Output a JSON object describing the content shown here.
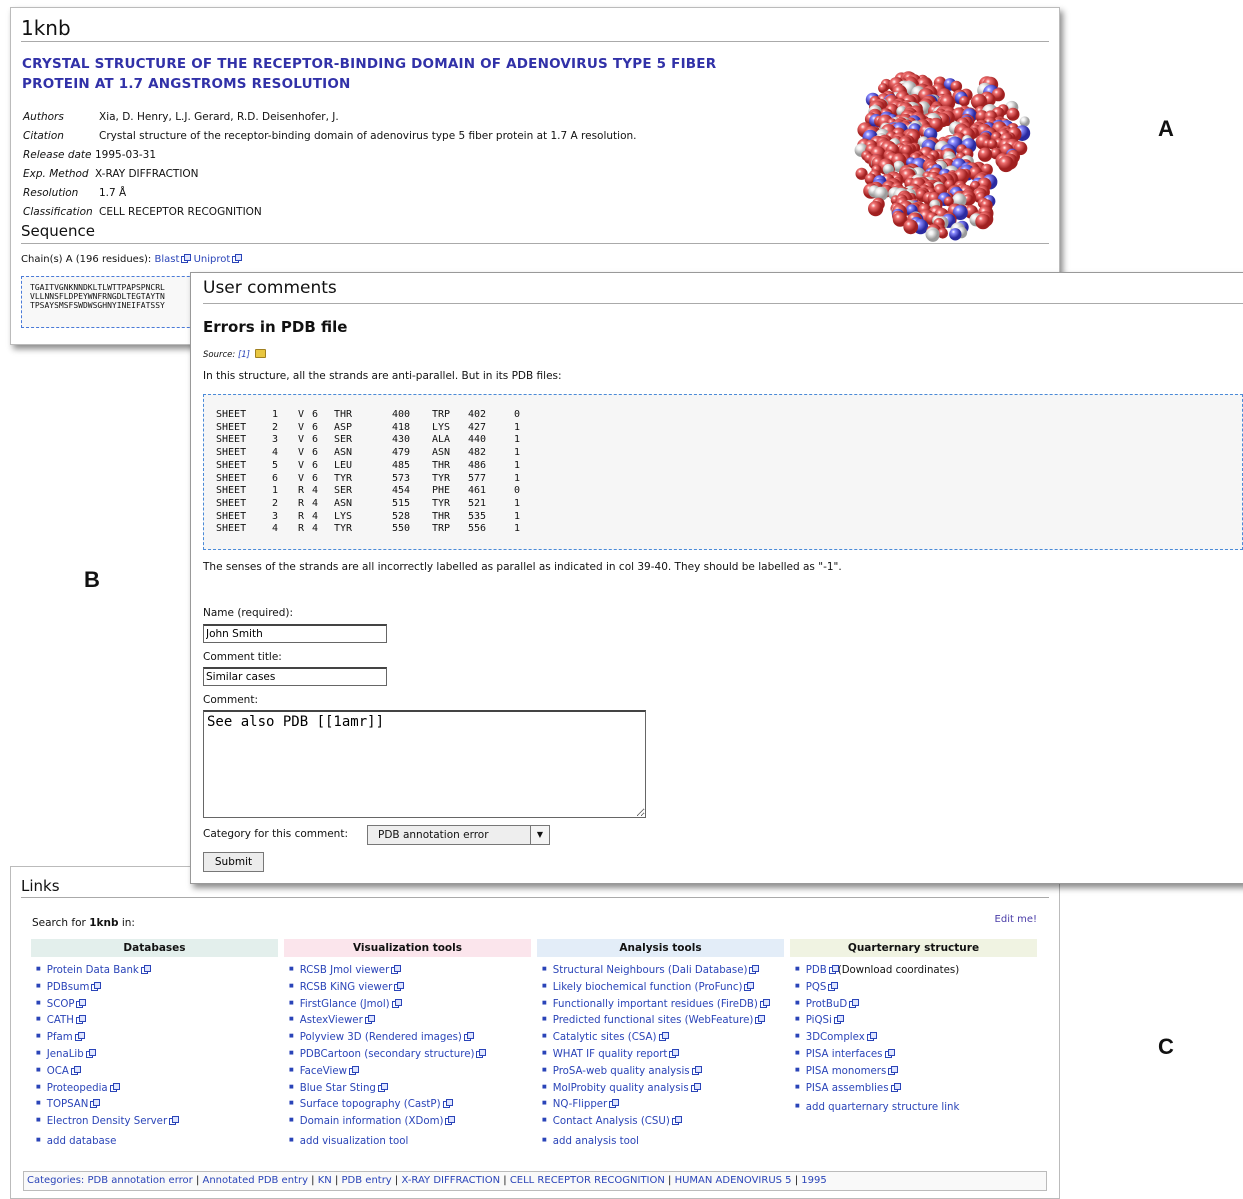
{
  "panel_a": {
    "page_title": "1knb",
    "title": "CRYSTAL STRUCTURE OF THE RECEPTOR-BINDING DOMAIN OF ADENOVIRUS TYPE 5 FIBER PROTEIN AT 1.7 ANGSTROMS RESOLUTION",
    "meta": [
      {
        "key": "Authors",
        "value": "Xia, D. Henry, L.J. Gerard, R.D. Deisenhofer, J."
      },
      {
        "key": "Citation",
        "value": "Crystal structure of the receptor-binding domain of adenovirus type 5 fiber protein at 1.7 A resolution."
      },
      {
        "key": "Release date",
        "value": "1995-03-31"
      },
      {
        "key": "Exp. Method",
        "value": "X-RAY DIFFRACTION"
      },
      {
        "key": "Resolution",
        "value": "1.7 Å"
      },
      {
        "key": "Classification",
        "value": "CELL RECEPTOR RECOGNITION"
      }
    ],
    "sequence_heading": "Sequence",
    "chain_text": "Chain(s) A (196 residues):",
    "blast_link": "Blast",
    "uniprot_link": "Uniprot",
    "sequence_lines": [
      "TGAITVGNKNNDKLTLWTTPAPSPNCRL",
      "VLLNNSFLDPEYWNFRNGDLTEGTAYTN",
      "TPSAYSMSFSWDWSGHNYINEIFATSSY"
    ]
  },
  "labels": {
    "a": "A",
    "b": "B",
    "c": "C"
  },
  "panel_b": {
    "heading": "User comments",
    "comment_title": "Errors in PDB file",
    "source_label": "Source:",
    "source_link": "[1]",
    "intro": "In this structure, all the strands are anti-parallel. But in its PDB files:",
    "sheet_rows": [
      [
        "SHEET",
        "1",
        "V",
        "6",
        "THR",
        "400",
        "TRP",
        "402",
        "0"
      ],
      [
        "SHEET",
        "2",
        "V",
        "6",
        "ASP",
        "418",
        "LYS",
        "427",
        "1"
      ],
      [
        "SHEET",
        "3",
        "V",
        "6",
        "SER",
        "430",
        "ALA",
        "440",
        "1"
      ],
      [
        "SHEET",
        "4",
        "V",
        "6",
        "ASN",
        "479",
        "ASN",
        "482",
        "1"
      ],
      [
        "SHEET",
        "5",
        "V",
        "6",
        "LEU",
        "485",
        "THR",
        "486",
        "1"
      ],
      [
        "SHEET",
        "6",
        "V",
        "6",
        "TYR",
        "573",
        "TYR",
        "577",
        "1"
      ],
      [
        "SHEET",
        "1",
        "R",
        "4",
        "SER",
        "454",
        "PHE",
        "461",
        "0"
      ],
      [
        "SHEET",
        "2",
        "R",
        "4",
        "ASN",
        "515",
        "TYR",
        "521",
        "1"
      ],
      [
        "SHEET",
        "3",
        "R",
        "4",
        "LYS",
        "528",
        "THR",
        "535",
        "1"
      ],
      [
        "SHEET",
        "4",
        "R",
        "4",
        "TYR",
        "550",
        "TRP",
        "556",
        "1"
      ]
    ],
    "sense_text": "The senses of the strands are all incorrectly labelled as parallel as indicated in col 39-40. They should be labelled as \"-1\".",
    "name_label": "Name (required):",
    "name_value": "John Smith",
    "comment_title_label": "Comment title:",
    "comment_title_value": "Similar cases",
    "comment_label": "Comment:",
    "comment_value": "See also PDB [[1amr]]",
    "category_label": "Category for this comment:",
    "category_value": "PDB annotation error",
    "submit_label": "Submit"
  },
  "panel_c": {
    "heading": "Links",
    "search_prefix": "Search for",
    "search_term": "1knb",
    "search_suffix": "in:",
    "edit_link": "Edit me!",
    "columns": [
      {
        "header": "Databases",
        "color": "#e3efec",
        "items": [
          "Protein Data Bank",
          "PDBsum",
          "SCOP",
          "CATH",
          "Pfam",
          "JenaLib",
          "OCA",
          "Proteopedia",
          "TOPSAN",
          "Electron Density Server"
        ],
        "add": "add database"
      },
      {
        "header": "Visualization tools",
        "color": "#fbe5ec",
        "items": [
          "RCSB Jmol viewer",
          "RCSB KiNG viewer",
          "FirstGlance (Jmol)",
          "AstexViewer",
          "Polyview 3D (Rendered images)",
          "PDBCartoon (secondary structure)",
          "FaceView",
          "Blue Star Sting",
          "Surface topography (CastP)",
          "Domain information (XDom)"
        ],
        "add": "add visualization tool"
      },
      {
        "header": "Analysis tools",
        "color": "#e3edf8",
        "items": [
          "Structural Neighbours (Dali Database)",
          "Likely biochemical function (ProFunc)",
          "Functionally important residues (FireDB)",
          "Predicted functional sites (WebFeature)",
          "Catalytic sites (CSA)",
          "WHAT IF quality report",
          "ProSA-web quality analysis",
          "MolProbity quality analysis",
          "NQ-Flipper",
          "Contact Analysis (CSU)"
        ],
        "add": "add analysis tool"
      },
      {
        "header": "Quarternary structure",
        "color": "#f0f3e2",
        "items": [
          "PDB",
          "PQS",
          "ProtBuD",
          "PiQSi",
          "3DComplex",
          "PISA interfaces",
          "PISA monomers",
          "PISA assemblies"
        ],
        "first_suffix": "(Download coordinates)",
        "add": "add quarternary structure link"
      }
    ],
    "categories_label": "Categories:",
    "categories": [
      "PDB annotation error",
      "Annotated PDB entry",
      "KN",
      "PDB entry",
      "X-RAY DIFFRACTION",
      "CELL RECEPTOR RECOGNITION",
      "HUMAN ADENOVIRUS 5",
      "1995"
    ]
  }
}
